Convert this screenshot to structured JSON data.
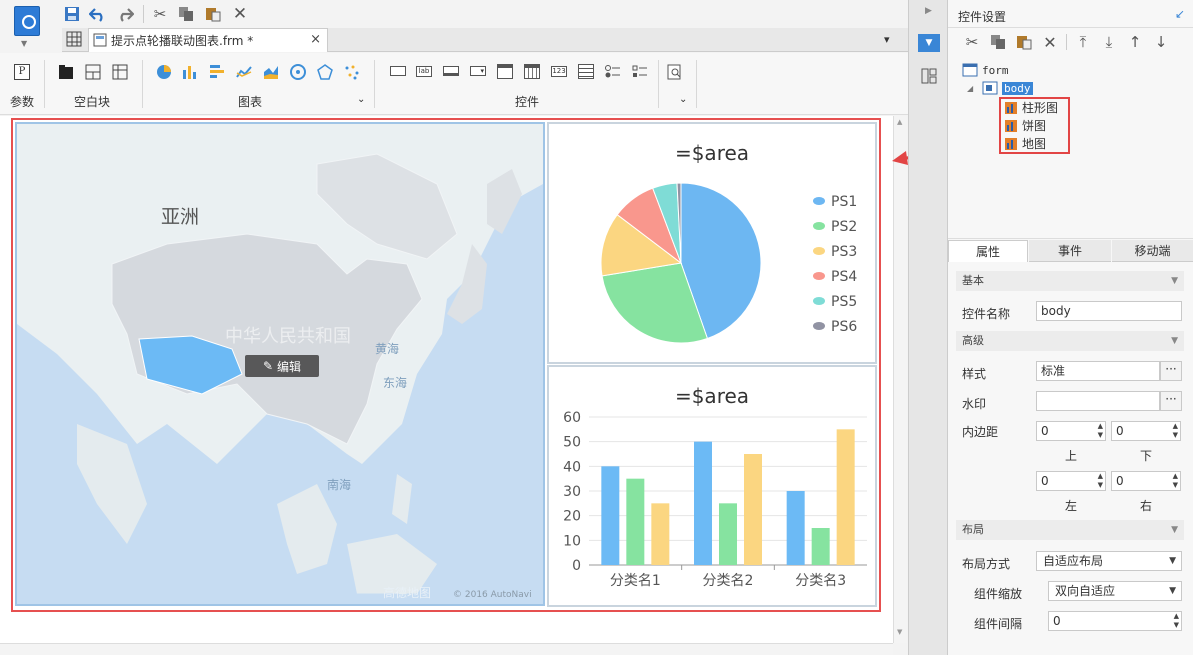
{
  "tab": {
    "title": "提示点轮播联动图表.frm *",
    "close": "×"
  },
  "ribbon": {
    "groups": [
      {
        "label": "参数"
      },
      {
        "label": "空白块"
      },
      {
        "label": "图表"
      },
      {
        "label": "控件"
      }
    ],
    "param_glyph": "P",
    "ctl_lab": "lab",
    "ctl_123": "123"
  },
  "map": {
    "continent": "亚洲",
    "watermark_cn": "中华人民共和国",
    "sea_yellow": "黄海",
    "sea_east": "东海",
    "sea_south": "南海",
    "edit_label": "编辑",
    "brand": "高德地图",
    "copyright": "© 2016 AutoNavi"
  },
  "chart_data": [
    {
      "type": "pie",
      "title": "=$area",
      "categories": [
        "PS1",
        "PS2",
        "PS3",
        "PS4",
        "PS5",
        "PS6"
      ],
      "values": [
        45,
        28,
        13,
        9,
        5,
        0.8
      ],
      "colors": [
        "#6db7f2",
        "#86e3a0",
        "#fbd681",
        "#f9978d",
        "#7fdcd6",
        "#9193a3"
      ],
      "legend": "right"
    },
    {
      "type": "bar",
      "title": "=$area",
      "categories": [
        "分类名1",
        "分类名2",
        "分类名3"
      ],
      "series": [
        {
          "values": [
            40,
            50,
            30
          ],
          "color": "#6cbaf5"
        },
        {
          "values": [
            35,
            25,
            15
          ],
          "color": "#86e3a0"
        },
        {
          "values": [
            25,
            45,
            55
          ],
          "color": "#fbd681"
        }
      ],
      "ylim": [
        0,
        60
      ],
      "yticks": [
        0,
        10,
        20,
        30,
        40,
        50,
        60
      ],
      "grid": true
    }
  ],
  "right_panel": {
    "title": "控件设置",
    "tree": {
      "root": "form",
      "body": "body",
      "children": [
        "柱形图",
        "饼图",
        "地图"
      ]
    },
    "tabs": [
      "属性",
      "事件",
      "移动端"
    ],
    "sections": {
      "basic": "基本",
      "advanced": "高级",
      "layout": "布局"
    },
    "fields": {
      "name_label": "控件名称",
      "name_value": "body",
      "style_label": "样式",
      "style_value": "标准",
      "watermark_label": "水印",
      "watermark_value": "",
      "padding_label": "内边距",
      "pad_top": "0",
      "pad_bottom": "0",
      "pad_left": "0",
      "pad_right": "0",
      "top": "上",
      "bottom": "下",
      "left": "左",
      "right": "右",
      "layout_mode_label": "布局方式",
      "layout_mode_value": "自适应布局",
      "scale_label": "组件缩放",
      "scale_value": "双向自适应",
      "gap_label": "组件间隔",
      "gap_value": "0"
    }
  }
}
